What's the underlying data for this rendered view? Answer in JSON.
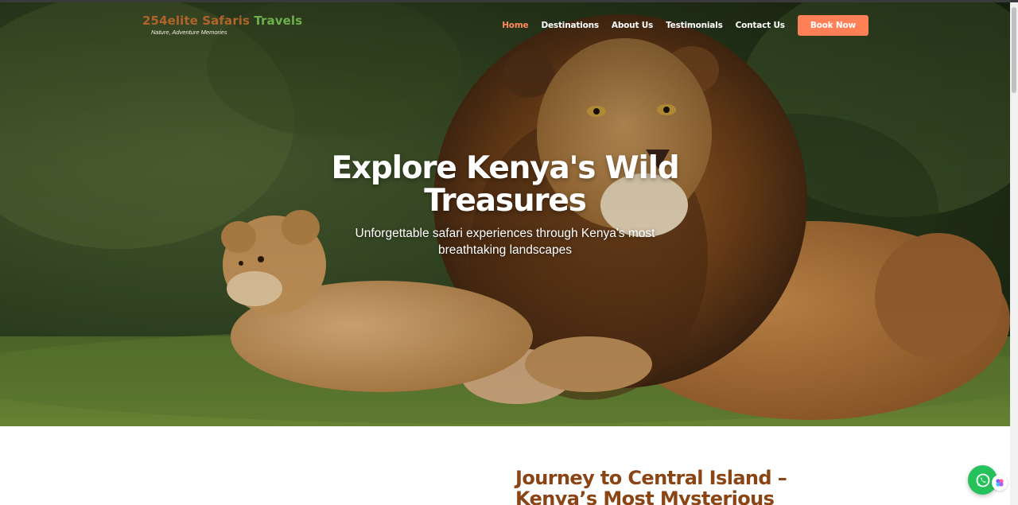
{
  "brand": {
    "name_part1": "254elite Safaris",
    "name_part2": "Travels",
    "tagline": "Nature, Adventure Memories"
  },
  "nav": {
    "items": [
      {
        "label": "Home",
        "active": true
      },
      {
        "label": "Destinations",
        "active": false
      },
      {
        "label": "About Us",
        "active": false
      },
      {
        "label": "Testimonials",
        "active": false
      },
      {
        "label": "Contact Us",
        "active": false
      }
    ],
    "cta_label": "Book Now"
  },
  "hero": {
    "title": "Explore Kenya's Wild Treasures",
    "subtitle": "Unforgettable safari experiences through Kenya's most breathtaking landscapes",
    "image_icon": "lion-and-cub-photo"
  },
  "section": {
    "title": "Journey to Central Island – Kenya’s Most Mysterious"
  },
  "floating": {
    "whatsapp_icon": "whatsapp-icon",
    "extension_icon": "extension-icon"
  },
  "colors": {
    "accent": "#ff7f57",
    "active_nav": "#ff8a5b",
    "brand_brown": "#b0632a",
    "brand_green": "#6bb04a",
    "heading_brown": "#8b4514",
    "whatsapp": "#25c15a"
  }
}
